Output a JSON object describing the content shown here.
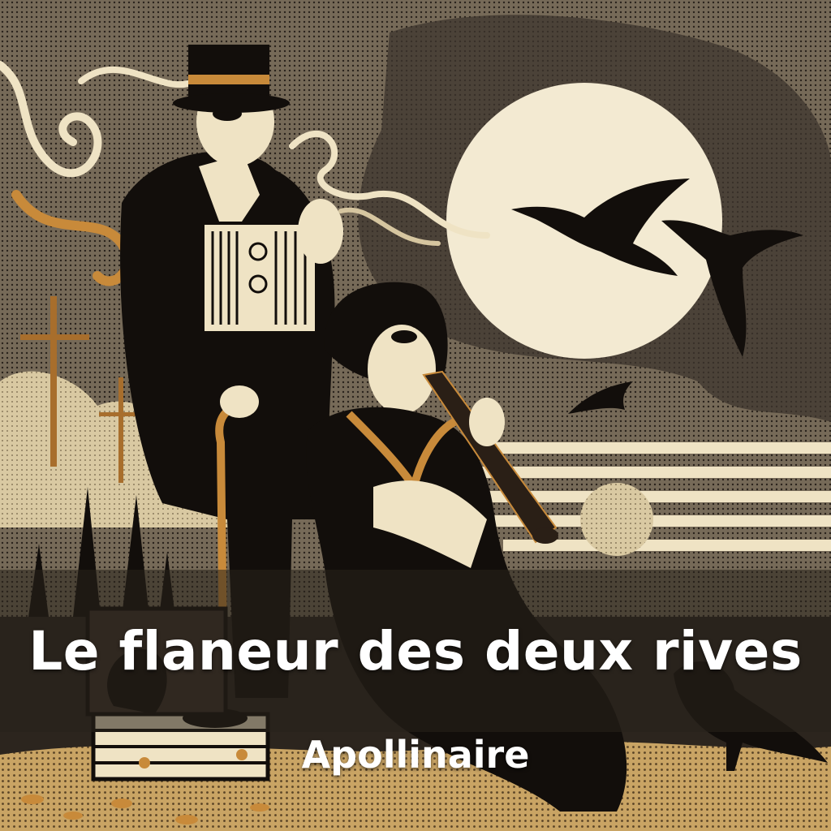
{
  "cover": {
    "title": "Le flaneur des deux rives",
    "author": "Apollinaire"
  },
  "colors": {
    "sky": "#6b6050",
    "cloud_dark": "#3d352d",
    "moon": "#f3ead2",
    "cream": "#efe3c4",
    "ochre": "#c88a3a",
    "black": "#120e0b",
    "sand": "#c9a464",
    "text": "#ffffff"
  },
  "icons": [
    "bird-icon",
    "moon-icon",
    "accordion-icon",
    "clarinet-icon",
    "top-hat-icon",
    "cross-icon"
  ]
}
